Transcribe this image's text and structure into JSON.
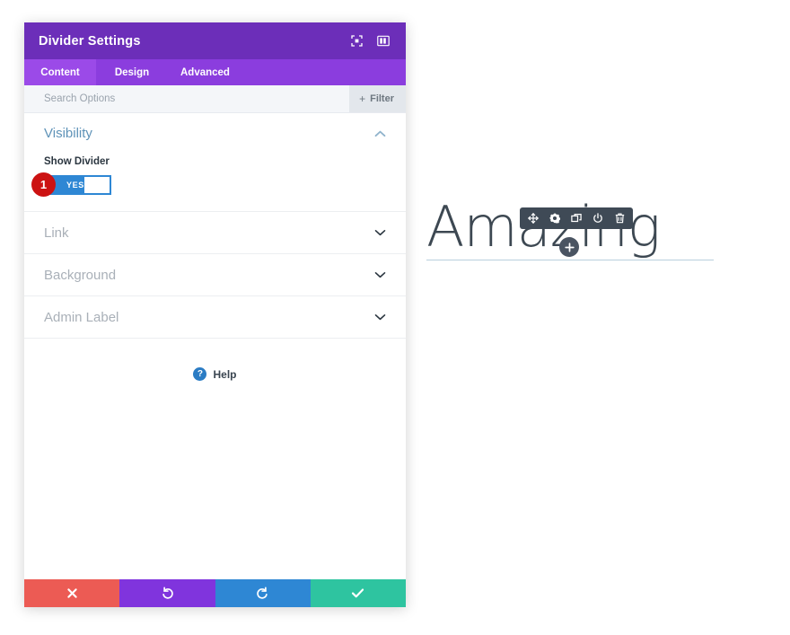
{
  "panel": {
    "title": "Divider Settings",
    "header_icons": [
      {
        "name": "fullscreen-icon"
      },
      {
        "name": "layout-columns-icon"
      }
    ],
    "tabs": [
      {
        "label": "Content",
        "active": true
      },
      {
        "label": "Design",
        "active": false
      },
      {
        "label": "Advanced",
        "active": false
      }
    ],
    "search": {
      "placeholder": "Search Options",
      "value": ""
    },
    "filter": {
      "plus": "+",
      "label": "Filter"
    },
    "visibility": {
      "title": "Visibility",
      "chevron": "chevron-up-icon",
      "show_divider": {
        "label": "Show Divider",
        "toggle_value": "YES",
        "state": "on",
        "accent_color": "#2e87d4"
      },
      "step_badge": "1",
      "step_badge_color": "#cc1212"
    },
    "collapsed_sections": [
      {
        "label": "Link",
        "chevron": "chevron-down-icon"
      },
      {
        "label": "Background",
        "chevron": "chevron-down-icon"
      },
      {
        "label": "Admin Label",
        "chevron": "chevron-down-icon"
      }
    ],
    "help": {
      "icon": "question-mark-icon",
      "label": "Help"
    },
    "footer_buttons": [
      {
        "name": "cancel-button",
        "icon": "close-x-icon",
        "color": "#ec5b54"
      },
      {
        "name": "undo-button",
        "icon": "undo-arrow-icon",
        "color": "#8034dd"
      },
      {
        "name": "redo-button",
        "icon": "redo-arrow-icon",
        "color": "#2e87d4"
      },
      {
        "name": "save-button",
        "icon": "checkmark-icon",
        "color": "#2ec4a0"
      }
    ]
  },
  "preview": {
    "heading_text": "Amazing",
    "divider_color": "#b9cfdd",
    "toolbar": {
      "background": "#3f4a56",
      "icons": [
        {
          "name": "move-icon"
        },
        {
          "name": "gear-icon"
        },
        {
          "name": "duplicate-icon"
        },
        {
          "name": "power-icon"
        },
        {
          "name": "trash-icon"
        }
      ]
    },
    "add_module_button": {
      "name": "add-module-button",
      "icon": "plus-icon"
    }
  }
}
